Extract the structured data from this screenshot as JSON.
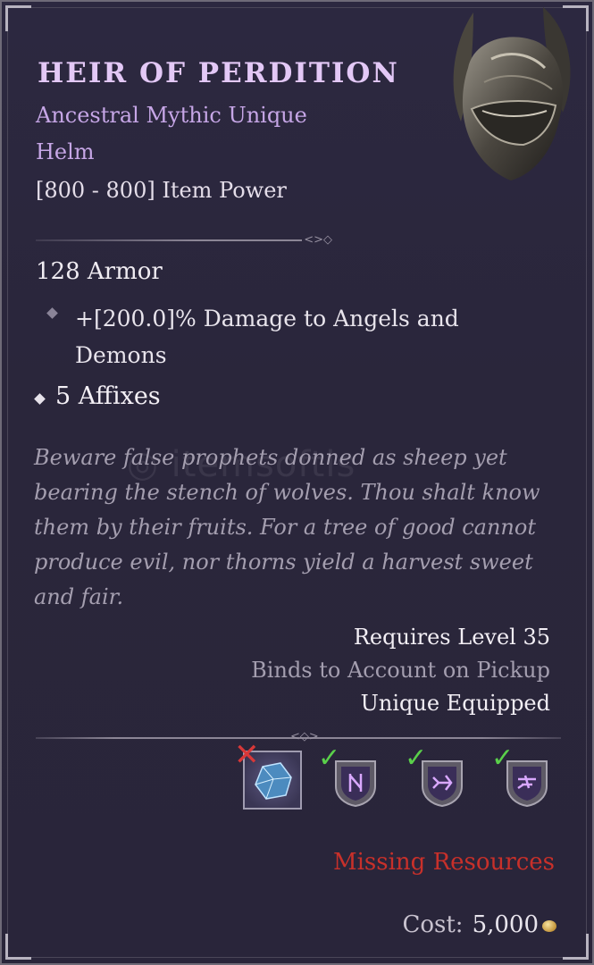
{
  "item": {
    "name": "Heir of Perdition",
    "rarity_line": "Ancestral Mythic Unique",
    "type": "Helm",
    "item_power": "[800 - 800] Item Power",
    "armor": "128 Armor",
    "affix": "+[200.0]% Damage to Angels and Demons",
    "affix_count": "5 Affixes",
    "flavor": "Beware false prophets donned as sheep yet bearing the stench of wolves. Thou shalt know them by their fruits. For a tree of good cannot produce evil, nor thorns yield a harvest sweet and fair.",
    "requires_level": "Requires Level 35",
    "binds": "Binds to Account on Pickup",
    "unique_equipped": "Unique Equipped"
  },
  "resources": {
    "slots": [
      {
        "icon": "gem-resource-icon",
        "status": "missing"
      },
      {
        "icon": "rune-icon",
        "status": "available"
      },
      {
        "icon": "rune-icon",
        "status": "available"
      },
      {
        "icon": "rune-icon",
        "status": "available"
      }
    ],
    "missing_label": "Missing Resources",
    "cost_label": "Cost:",
    "cost_value": "5,000"
  },
  "watermark": "itemsoftis",
  "colors": {
    "title": "#e3c8f6",
    "rarity": "#c6a6e6",
    "flavor": "#a49eaf",
    "missing": "#c8302a",
    "check": "#5ad04a",
    "x_mark": "#d83838"
  }
}
